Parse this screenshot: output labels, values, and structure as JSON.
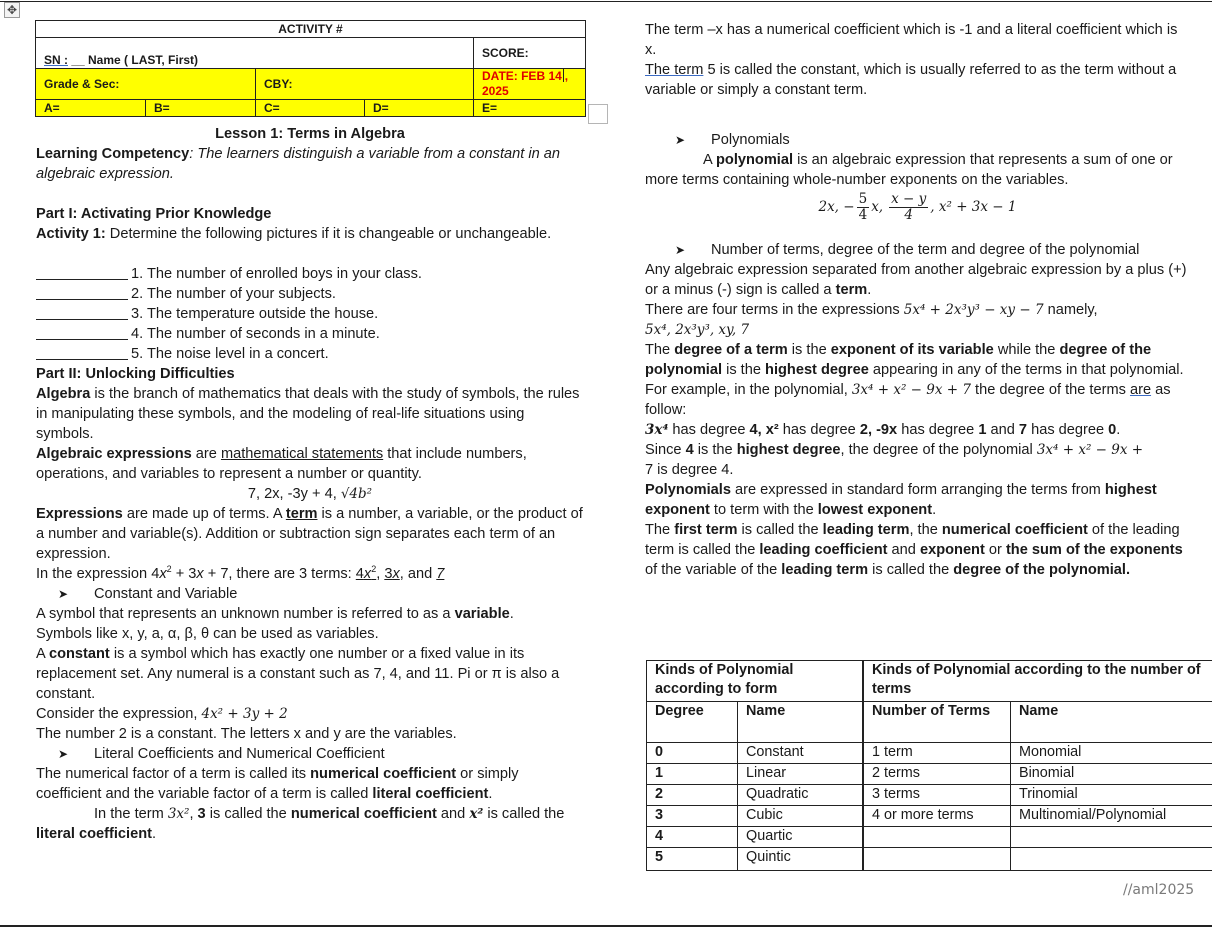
{
  "header": {
    "activity_label": "ACTIVITY  #",
    "sn_label": "SN :",
    "sn_blank": " __ ",
    "name_label": "Name ( LAST, First)",
    "score_label": "SCORE:",
    "grade_label": "Grade & Sec:",
    "cby_label": "CBY:",
    "date_label": "DATE:  FEB 14",
    "date_year": ", 2025",
    "a_label": "A=",
    "b_label": "B=",
    "c_label": "C=",
    "d_label": "D=",
    "e_label": "E="
  },
  "left": {
    "lesson_title": "Lesson 1: Terms in Algebra",
    "competency_label": "Learning Competency",
    "competency_text": ": The learners distinguish a variable from a constant in an algebraic expression.",
    "part1_title": "Part I: Activating Prior Knowledge",
    "activity1_label": "Activity 1:",
    "activity1_text": " Determine the following pictures if it is changeable or unchangeable.",
    "items": [
      "1. The number of enrolled boys in your class.",
      "2. The number of your subjects.",
      "3. The temperature outside the house.",
      "4. The number of seconds in a minute.",
      "5. The noise level in a concert."
    ],
    "part2_title": "Part II: Unlocking Difficulties",
    "algebra_bold": "Algebra",
    "algebra_text": " is the branch of mathematics that deals with the study of symbols, the rules in manipulating these symbols, and the modeling of real-life situations using symbols.",
    "algexp_bold": "Algebraic expressions",
    "algexp_mid": " are ",
    "algexp_underline": "mathematical statements",
    "algexp_text": " that include numbers, operations, and variables to represent a number or quantity.",
    "examples_line": "7, 2x, -3y + 4, ",
    "examples_sqrt": "√4b²",
    "expr_bold": "Expressions",
    "expr_text1": " are made up of terms. A ",
    "expr_term": "term",
    "expr_text2": " is a number, a variable, or the product of a number and variable(s). Addition or subtraction sign separates each term of an expression.",
    "inexpr_text1": "In the expression 4",
    "inexpr_text2": " + 3",
    "inexpr_text3": " + 7, there are 3 terms: ",
    "inexpr_and": ", and ",
    "bullet_const_var": "Constant and Variable",
    "variable_text1": "A symbol that represents an unknown number is referred to as a ",
    "variable_bold": "variable",
    "symbols_text": "Symbols like x, y, a, α, β, θ can be used as variables.",
    "constant_text1": "A ",
    "constant_bold": "constant",
    "constant_text2": " is a symbol which has exactly one number or a fixed value in its replacement set. Any numeral is a constant such as 7, 4, and 11. Pi or π is also a constant.",
    "consider_text": "Consider the expression, ",
    "consider_expr": "4x² + 3y + 2",
    "number2_text": "The number 2 is a constant. The letters x and y are the variables.",
    "bullet_coeff": "Literal Coefficients and Numerical Coefficient",
    "numfactor_text1": "The numerical factor of a term is called its ",
    "numfactor_bold1": "numerical coefficient",
    "numfactor_text2": " or simply coefficient and the variable factor of a term is called ",
    "numfactor_bold2": "literal coefficient",
    "interm_text1": "In the term ",
    "interm_expr": "3x²",
    "interm_text2": ", ",
    "interm_bold3": "3",
    "interm_text3": " is called the ",
    "interm_bold_num": "numerical coefficient",
    "interm_text4": " and ",
    "interm_x2": "x²",
    "interm_text5": " is called the ",
    "interm_bold_lit": "literal coefficient"
  },
  "right": {
    "negx_text": "The term –x has a numerical coefficient which is -1 and a literal coefficient which is x.",
    "term5_link": "The term",
    "term5_text": " 5 is called the constant, which is usually referred to as the term without a variable or simply a constant term.",
    "bullet_poly": "Polynomials",
    "poly_text1": "A ",
    "poly_bold": "polynomial",
    "poly_text2": " is an algebraic expression that represents a sum of one or more terms containing whole-number exponents on the variables.",
    "poly_ex1": "2x,  −",
    "poly_ex_frac1_num": "5",
    "poly_ex_frac1_den": "4",
    "poly_ex2": "x,",
    "poly_ex_frac2_num": "x − y",
    "poly_ex_frac2_den": "4",
    "poly_ex3": ", x² + 3x − 1",
    "bullet_terms": "Number of terms, degree of the term and degree of the polynomial",
    "any_text1": "Any algebraic expression separated from another algebraic expression by a plus (+) or a minus (-) sign is called a ",
    "any_bold": "term",
    "four_text": "There are four terms in the expressions ",
    "four_expr": "5x⁴ + 2x³y³ − xy − 7",
    "four_namely": " namely,",
    "four_list": "5x⁴, 2x³y³, xy, 7",
    "deg_t1": "The ",
    "deg_b1": "degree of a term",
    "deg_t2": " is the ",
    "deg_b2": "exponent of its variable",
    "deg_t3": " while the ",
    "deg_b3": "degree of the polynomial",
    "deg_t4": " is the ",
    "deg_b4": "highest degree",
    "deg_t5": " appearing in any of the terms in that polynomial. For example, in the polynomial, ",
    "deg_expr": "3x⁴ + x² − 9x + 7",
    "deg_t6": " the degree of the terms ",
    "deg_are": "are",
    "deg_t7": " as follow:",
    "has_b1": "3x⁴",
    "has_t1": " has degree ",
    "has_b2": "4, x²",
    "has_t2": " has degree ",
    "has_b3": "2, -9x",
    "has_t3": " has degree ",
    "has_b4": "1",
    "has_t4": " and ",
    "has_b5": "7",
    "has_t5": " has degree ",
    "has_b6": "0",
    "since_t1": "Since ",
    "since_b1": "4",
    "since_t2": " is the ",
    "since_b2": "highest degree",
    "since_t3": ", the degree of the polynomial ",
    "since_expr": "3x⁴ + x² − 9x +",
    "since_t4": "7 is degree 4.",
    "std_b1": "Polynomials",
    "std_t1": " are expressed in standard form arranging the terms from ",
    "std_b2": "highest exponent",
    "std_t2": " to  term with the ",
    "std_b3": "lowest exponent",
    "lead_t1": "The ",
    "lead_b1": "first term",
    "lead_t2": " is called the ",
    "lead_b2": "leading term",
    "lead_t3": ", the ",
    "lead_b3": "numerical coefficient",
    "lead_t4": " of the leading term is called the ",
    "lead_b4": "leading coefficient",
    "lead_t5": " and ",
    "lead_b5": "exponent",
    "lead_t6": " or ",
    "lead_b6": "the sum of the exponents",
    "lead_t7": " of the variable of the ",
    "lead_b7": "leading term",
    "lead_t8": " is called the ",
    "lead_b8": "degree of the polynomial."
  },
  "poly_table": {
    "group1": "Kinds of Polynomial according to form",
    "group2": "Kinds of Polynomial according to the number of terms",
    "col_degree": "Degree",
    "col_name1": "Name",
    "col_num_terms": "Number of Terms",
    "col_name2": "Name",
    "rows": [
      {
        "degree": "0",
        "name": "Constant",
        "terms": "1 term",
        "kind": "Monomial"
      },
      {
        "degree": "1",
        "name": "Linear",
        "terms": "2 terms",
        "kind": "Binomial"
      },
      {
        "degree": "2",
        "name": "Quadratic",
        "terms": "3 terms",
        "kind": "Trinomial"
      },
      {
        "degree": "3",
        "name": "Cubic",
        "terms": "4 or more terms",
        "kind": "Multinomial/Polynomial"
      },
      {
        "degree": "4",
        "name": "Quartic",
        "terms": "",
        "kind": ""
      },
      {
        "degree": "5",
        "name": "Quintic",
        "terms": "",
        "kind": ""
      }
    ]
  },
  "signature": "//aml2025",
  "icons": {
    "move": "move-arrows-icon",
    "resize": "resize-handle-icon",
    "bullet": "arrowhead-bullet-icon"
  }
}
